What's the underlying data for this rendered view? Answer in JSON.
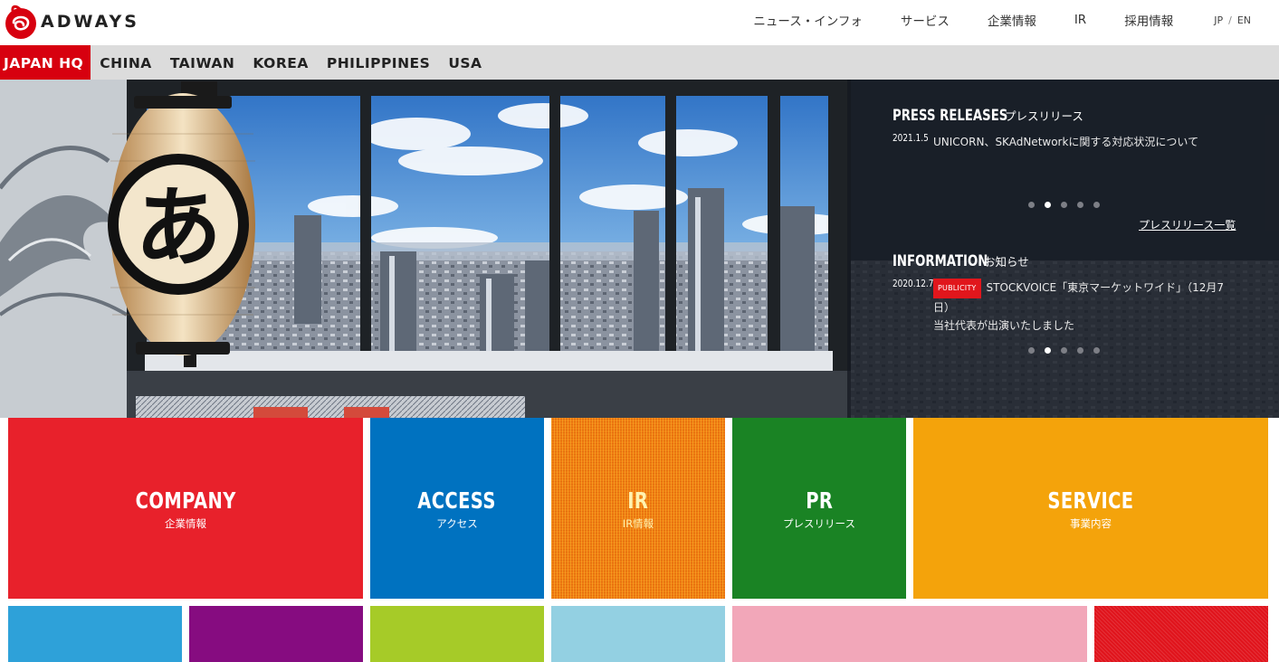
{
  "header": {
    "logo_text": "ADWAYS",
    "nav": [
      {
        "label": "ニュース・インフォ"
      },
      {
        "label": "サービス"
      },
      {
        "label": "企業情報"
      },
      {
        "label": "IR"
      },
      {
        "label": "採用情報"
      }
    ],
    "lang": {
      "jp": "JP",
      "sep": "/",
      "en": "EN"
    }
  },
  "regions": [
    {
      "label": "JAPAN HQ",
      "active": true
    },
    {
      "label": "CHINA"
    },
    {
      "label": "TAIWAN"
    },
    {
      "label": "KOREA"
    },
    {
      "label": "PHILIPPINES"
    },
    {
      "label": "USA"
    }
  ],
  "hero": {
    "press": {
      "title_en": "PRESS RELEASES",
      "title_ja": "プレスリリース",
      "date": "2021.1.5",
      "text": "UNICORN、SKAdNetworkに関する対応状況について",
      "list_link": "プレスリリース一覧",
      "active_dot": 1
    },
    "info": {
      "title_en": "INFORMATION",
      "title_ja": "お知らせ",
      "date": "2020.12.7",
      "badge": "PUBLICITY",
      "text_line1": "STOCKVOICE「東京マーケットワイド」（12月7",
      "text_line2": "日）",
      "text_line3": "当社代表が出演いたしました",
      "active_dot": 1
    }
  },
  "tiles": [
    {
      "en": "COMPANY",
      "ja": "企業情報",
      "color": "#e8212b"
    },
    {
      "en": "ACCESS",
      "ja": "アクセス",
      "color": "#0072c0"
    },
    {
      "en": "IR",
      "ja": "IR情報",
      "color": "#f07d12"
    },
    {
      "en": "PR",
      "ja": "プレスリリース",
      "color": "#1a8324"
    },
    {
      "en": "SERVICE",
      "ja": "事業内容",
      "color": "#f4a30b"
    }
  ],
  "small_tiles": [
    {
      "color": "#2ea1d9"
    },
    {
      "color": "#860c80"
    },
    {
      "color": "#a6cb28"
    },
    {
      "color": "#93d0e2"
    },
    {
      "color": "#f2a7b9"
    },
    {
      "color": "#e0141c"
    }
  ]
}
